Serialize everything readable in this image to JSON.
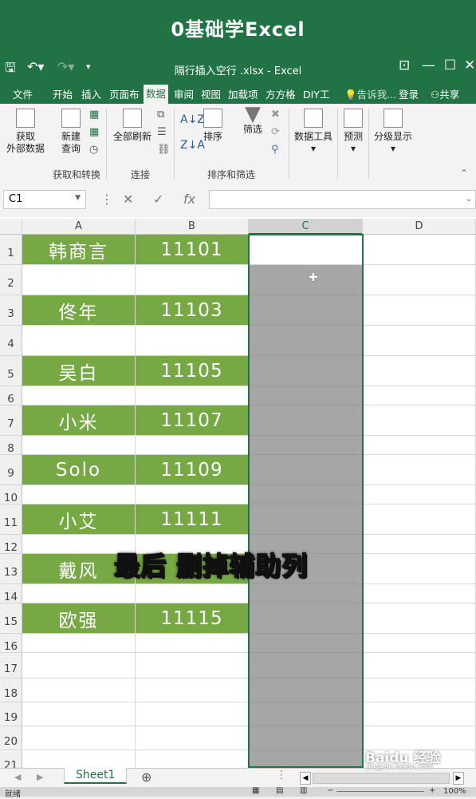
{
  "banner": {
    "text": "0基础学Excel"
  },
  "window": {
    "title": "隔行插入空行 .xlsx - Excel",
    "min_icon": "minimize-icon",
    "max_icon": "restore-icon",
    "close_icon": "close-icon"
  },
  "tabs": [
    "文件",
    "开始",
    "插入",
    "页面布",
    "数据",
    "审阅",
    "视图",
    "加载项",
    "方方格",
    "DIY工",
    "告诉我...",
    "登录",
    "共享"
  ],
  "active_tab": "数据",
  "ribbon": {
    "get_external": "获取\n外部数据",
    "new_query": "新建\n查询",
    "refresh_all": "全部刷新",
    "sort": "排序",
    "filter": "筛选",
    "data_tools": "数据工具",
    "forecast": "预测",
    "outline": "分级显示",
    "groups": [
      "获取和转换",
      "连接",
      "排序和筛选"
    ]
  },
  "formula_bar": {
    "name_box": "C1",
    "fx_label": "fx",
    "value": ""
  },
  "columns": [
    "A",
    "B",
    "C",
    "D"
  ],
  "rows": [
    {
      "n": "1",
      "a": "韩商言",
      "b": "11101"
    },
    {
      "n": "2",
      "a": "",
      "b": ""
    },
    {
      "n": "3",
      "a": "佟年",
      "b": "11103"
    },
    {
      "n": "4",
      "a": "",
      "b": ""
    },
    {
      "n": "5",
      "a": "吴白",
      "b": "11105"
    },
    {
      "n": "6",
      "a": "",
      "b": ""
    },
    {
      "n": "7",
      "a": "小米",
      "b": "11107"
    },
    {
      "n": "8",
      "a": "",
      "b": ""
    },
    {
      "n": "9",
      "a": "Solo",
      "b": "11109"
    },
    {
      "n": "10",
      "a": "",
      "b": ""
    },
    {
      "n": "11",
      "a": "小艾",
      "b": "11111"
    },
    {
      "n": "12",
      "a": "",
      "b": ""
    },
    {
      "n": "13",
      "a": "戴风",
      "b": ""
    },
    {
      "n": "14",
      "a": "",
      "b": ""
    },
    {
      "n": "15",
      "a": "欧强",
      "b": "11115"
    },
    {
      "n": "16",
      "a": "",
      "b": ""
    },
    {
      "n": "17",
      "a": "",
      "b": ""
    },
    {
      "n": "18",
      "a": "",
      "b": ""
    },
    {
      "n": "19",
      "a": "",
      "b": ""
    },
    {
      "n": "20",
      "a": "",
      "b": ""
    },
    {
      "n": "21",
      "a": "",
      "b": ""
    }
  ],
  "overlay_caption": "最后 删掉辅助列",
  "sheet_tab": "Sheet1",
  "status": {
    "ready": "就绪",
    "zoom": "100%"
  },
  "watermark": {
    "brand": "Baidu 经验",
    "url": "jingyan.baidu.com"
  },
  "colors": {
    "excel_green": "#217346",
    "cell_green": "#76a843",
    "selection_grey": "#a6a6a6"
  }
}
